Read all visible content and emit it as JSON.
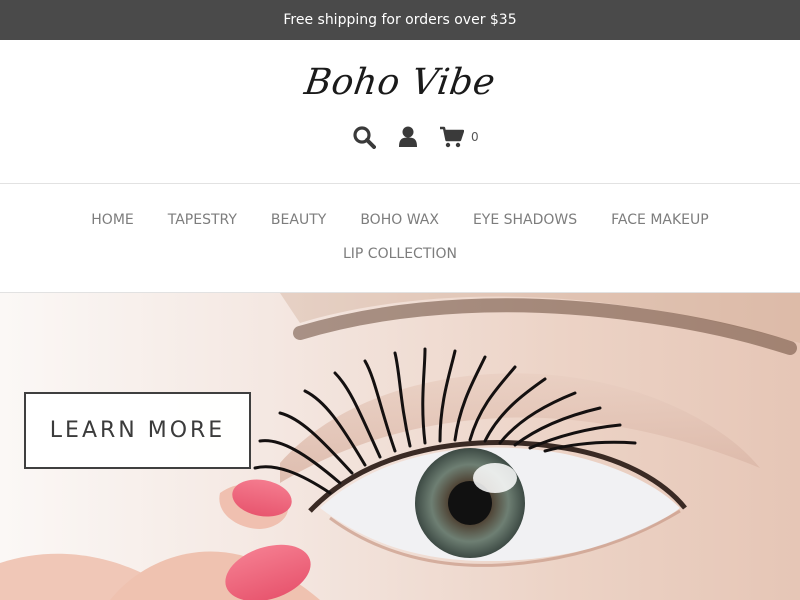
{
  "announcement": {
    "text": "Free shipping for orders over $35"
  },
  "header": {
    "logo": "Boho Vibe",
    "icons": {
      "search": "search-icon",
      "account": "user-icon",
      "cart": "shopping-cart-icon"
    },
    "cart_count": "0"
  },
  "nav": {
    "row1": [
      "HOME",
      "TAPESTRY",
      "BEAUTY",
      "BOHO WAX",
      "EYE SHADOWS",
      "FACE MAKEUP"
    ],
    "row2": [
      "LIP COLLECTION"
    ]
  },
  "hero": {
    "button_label": "LEARN MORE",
    "image_subject": "close-up of eye with false lashes"
  },
  "colors": {
    "announcement_bg": "#4a4a4a",
    "nav_text": "#7d7d7d",
    "border": "#e2e2e2"
  }
}
